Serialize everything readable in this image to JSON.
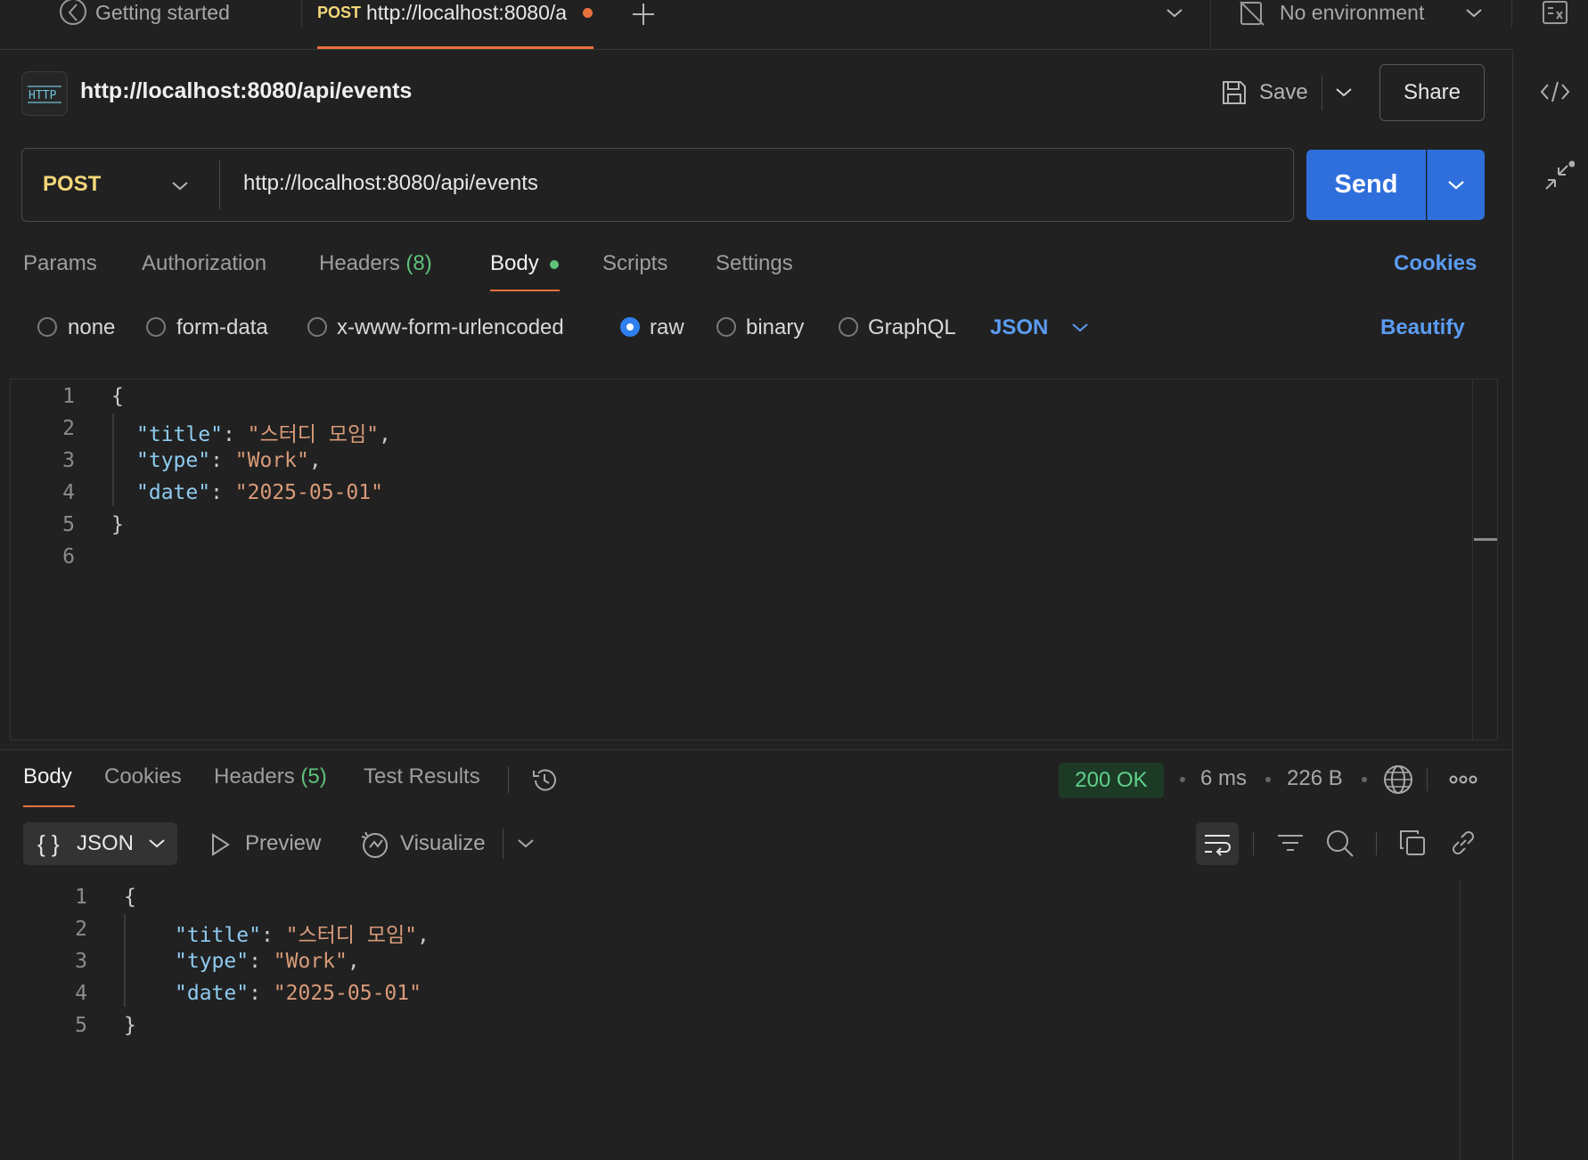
{
  "tabs": {
    "getting_started": "Getting started",
    "active_method": "POST",
    "active_url": "http://localhost:8080/a",
    "environment": "No environment"
  },
  "request": {
    "title": "http://localhost:8080/api/events",
    "http_badge": "HTTP",
    "save_label": "Save",
    "share_label": "Share",
    "method": "POST",
    "url": "http://localhost:8080/api/events",
    "send_label": "Send"
  },
  "request_tabs": {
    "params": "Params",
    "authorization": "Authorization",
    "headers": "Headers",
    "headers_count": "(8)",
    "body": "Body",
    "scripts": "Scripts",
    "settings": "Settings",
    "cookies": "Cookies"
  },
  "body_modes": {
    "none": "none",
    "form_data": "form-data",
    "urlencoded": "x-www-form-urlencoded",
    "raw": "raw",
    "binary": "binary",
    "graphql": "GraphQL",
    "format": "JSON",
    "beautify": "Beautify",
    "selected": "raw"
  },
  "request_body": {
    "line_numbers": [
      "1",
      "2",
      "3",
      "4",
      "5",
      "6"
    ],
    "open_brace": "{",
    "close_brace": "}",
    "fields": [
      {
        "key": "\"title\"",
        "value": "\"스터디 모임\"",
        "trail": ","
      },
      {
        "key": "\"type\"",
        "value": "\"Work\"",
        "trail": ","
      },
      {
        "key": "\"date\"",
        "value": "\"2025-05-01\"",
        "trail": ""
      }
    ]
  },
  "response_tabs": {
    "body": "Body",
    "cookies": "Cookies",
    "headers": "Headers",
    "headers_count": "(5)",
    "test_results": "Test Results"
  },
  "response_meta": {
    "status": "200 OK",
    "time": "6 ms",
    "size": "226 B"
  },
  "response_toolbar": {
    "format": "JSON",
    "preview": "Preview",
    "visualize": "Visualize"
  },
  "response_body": {
    "line_numbers": [
      "1",
      "2",
      "3",
      "4",
      "5"
    ],
    "open_brace": "{",
    "close_brace": "}",
    "fields": [
      {
        "key": "\"title\"",
        "value": "\"스터디 모임\"",
        "trail": ","
      },
      {
        "key": "\"type\"",
        "value": "\"Work\"",
        "trail": ","
      },
      {
        "key": "\"date\"",
        "value": "\"2025-05-01\"",
        "trail": ""
      }
    ]
  },
  "colors": {
    "background": "#212121",
    "accent_orange": "#e8703f",
    "send_blue": "#2f6fdc",
    "method_yellow": "#f3d77a",
    "success_green": "#5fd08a",
    "link_blue": "#5b9cf2",
    "json_key": "#8ecbf0",
    "json_string": "#d99b79"
  }
}
